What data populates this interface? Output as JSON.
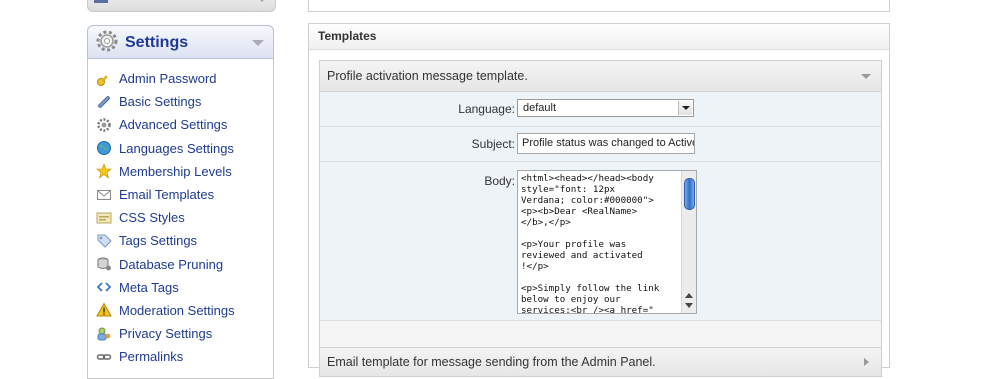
{
  "sidebar": {
    "section_title": "Settings",
    "items": [
      {
        "label": "Admin Password",
        "icon": "key-icon"
      },
      {
        "label": "Basic Settings",
        "icon": "wrench-icon"
      },
      {
        "label": "Advanced Settings",
        "icon": "gear-icon"
      },
      {
        "label": "Languages Settings",
        "icon": "globe-icon"
      },
      {
        "label": "Membership Levels",
        "icon": "star-icon"
      },
      {
        "label": "Email Templates",
        "icon": "envelope-icon"
      },
      {
        "label": "CSS Styles",
        "icon": "css-icon"
      },
      {
        "label": "Tags Settings",
        "icon": "tag-icon"
      },
      {
        "label": "Database Pruning",
        "icon": "database-icon"
      },
      {
        "label": "Meta Tags",
        "icon": "code-icon"
      },
      {
        "label": "Moderation Settings",
        "icon": "warning-icon"
      },
      {
        "label": "Privacy Settings",
        "icon": "lock-icon"
      },
      {
        "label": "Permalinks",
        "icon": "link-icon"
      }
    ]
  },
  "main": {
    "section_title": "Templates",
    "templates": [
      {
        "title": "Profile activation message template.",
        "language_label": "Language:",
        "language_value": "default",
        "subject_label": "Subject:",
        "subject_value": "Profile status was changed to Active",
        "body_label": "Body:",
        "body_value": "<html><head></head><body\nstyle=\"font: 12px\nVerdana; color:#000000\">\n<p><b>Dear <RealName>\n</b>,</p>\n\n<p>Your profile was\nreviewed and activated\n!</p>\n\n<p>Simply follow the link\nbelow to enjoy our\nservices:<br /><a href=\""
      },
      {
        "title": "Email template for message sending from the Admin Panel."
      }
    ]
  },
  "colors": {
    "link_blue": "#1f3a93",
    "panel_bg": "#eef3f8",
    "scroll_thumb": "#2f6fcf"
  }
}
